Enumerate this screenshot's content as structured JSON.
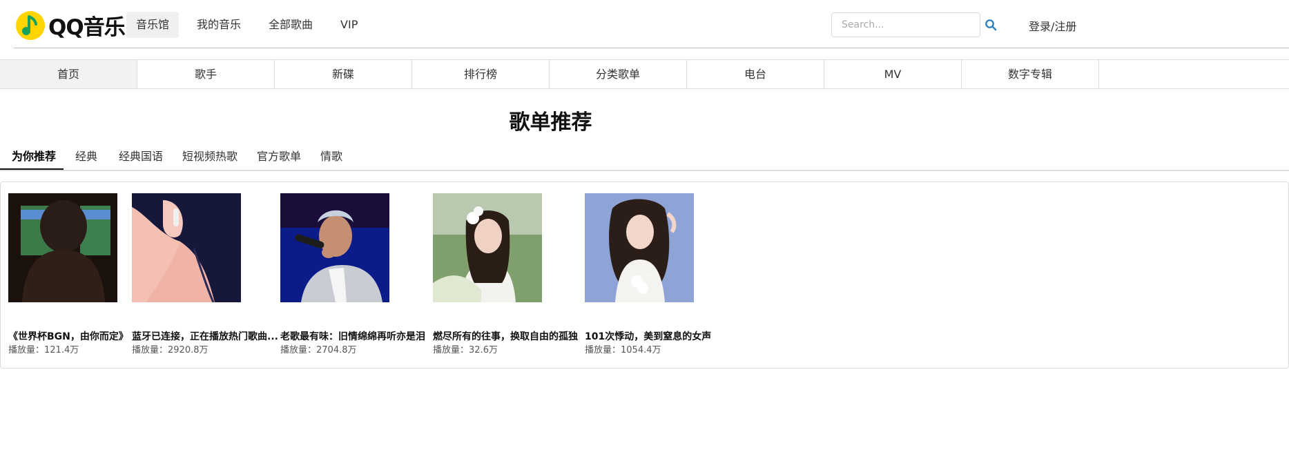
{
  "brand": {
    "name": "QQ音乐"
  },
  "topnav": [
    "音乐馆",
    "我的音乐",
    "全部歌曲",
    "VIP"
  ],
  "search": {
    "placeholder": "Search..."
  },
  "login": "登录/注册",
  "subnav": [
    "首页",
    "歌手",
    "新碟",
    "排行榜",
    "分类歌单",
    "电台",
    "MV",
    "数字专辑"
  ],
  "section": {
    "title": "歌单推荐"
  },
  "categories": [
    "为你推荐",
    "经典",
    "经典国语",
    "短视频热歌",
    "官方歌单",
    "情歌"
  ],
  "plays_label": "播放量：",
  "playlists": [
    {
      "title": "《世界杯BGN，由你而定》",
      "plays": "121.4万"
    },
    {
      "title": "蓝牙已连接，正在播放热门歌曲...",
      "plays": "2920.8万"
    },
    {
      "title": "老歌最有味：旧情绵绵再听亦是泪",
      "plays": "2704.8万"
    },
    {
      "title": "燃尽所有的往事，换取自由的孤独",
      "plays": "32.6万"
    },
    {
      "title": "101次悸动，美到窒息的女声",
      "plays": "1054.4万"
    }
  ],
  "colors": {
    "accent": "#31c27c",
    "logo_yellow": "#ffd400",
    "search_icon": "#2f7fc1"
  }
}
